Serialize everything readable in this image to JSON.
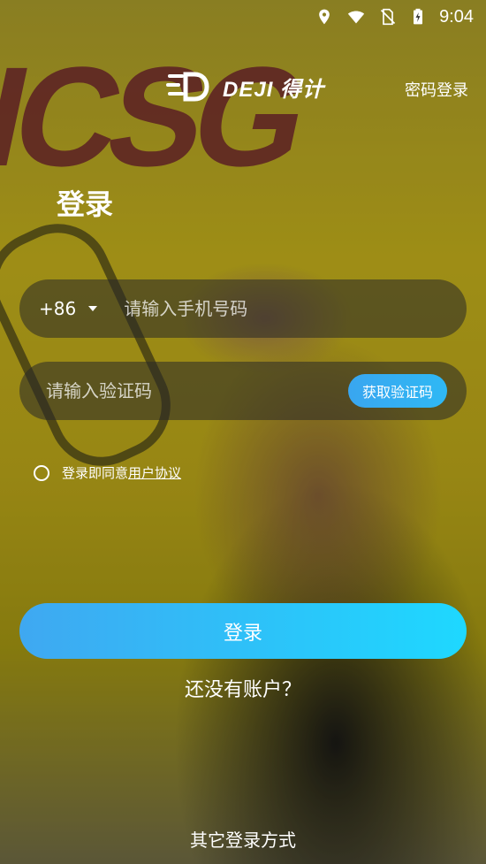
{
  "status": {
    "time": "9:04"
  },
  "header": {
    "logo_text": "DEJI 得计",
    "password_login": "密码登录"
  },
  "background": {
    "graffiti_text": "ICSG"
  },
  "main": {
    "title": "登录",
    "phone": {
      "country_code": "+86",
      "placeholder": "请输入手机号码"
    },
    "code": {
      "placeholder": "请输入验证码",
      "get_code_label": "获取验证码"
    },
    "agreement": {
      "prefix": "登录即同意",
      "link": "用户协议"
    },
    "login_button": "登录",
    "no_account": "还没有账户？",
    "other_login": "其它登录方式"
  },
  "colors": {
    "accent_start": "#3fa8f1",
    "accent_end": "#1ed8ff"
  },
  "icons": [
    "location-icon",
    "wifi-icon",
    "no-sim-icon",
    "battery-charging-icon",
    "logo-icon",
    "dropdown-caret-icon",
    "radio-icon"
  ]
}
